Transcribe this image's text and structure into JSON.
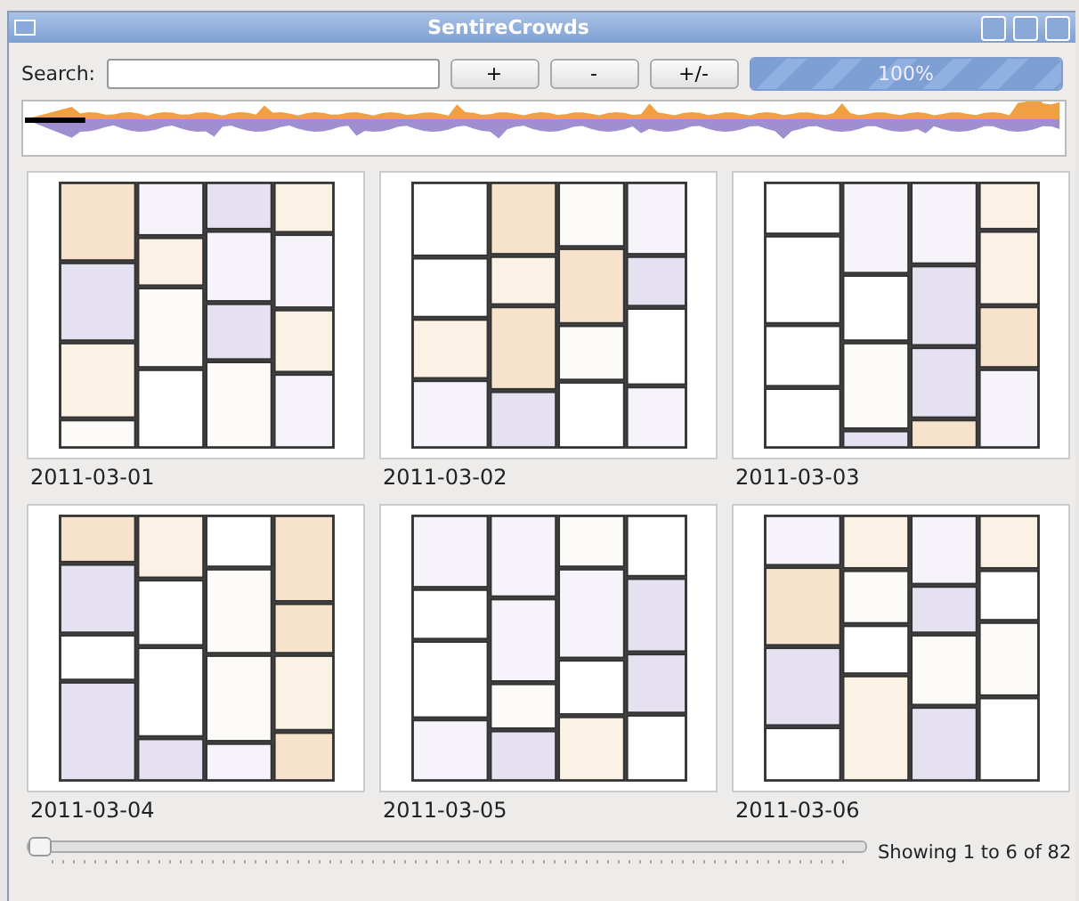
{
  "window": {
    "title": "SentireCrowds"
  },
  "search": {
    "label": "Search:"
  },
  "buttons": [
    "+",
    "-",
    "+/-"
  ],
  "progress": {
    "level": 1,
    "reading": "100%"
  },
  "thumbnails": [
    {
      "date": "2011-03-01",
      "kind": "picture"
    },
    {
      "date": "2011-03-02",
      "kind": "picture"
    },
    {
      "date": "2011-03-03",
      "kind": "picture"
    },
    {
      "date": "2011-03-04",
      "kind": "picture"
    },
    {
      "date": "2011-03-05",
      "kind": "picture"
    },
    {
      "date": "2011-03-06",
      "kind": "picture"
    }
  ],
  "pager": {
    "level": 0,
    "status": "Showing 1 to 6 of 82"
  }
}
